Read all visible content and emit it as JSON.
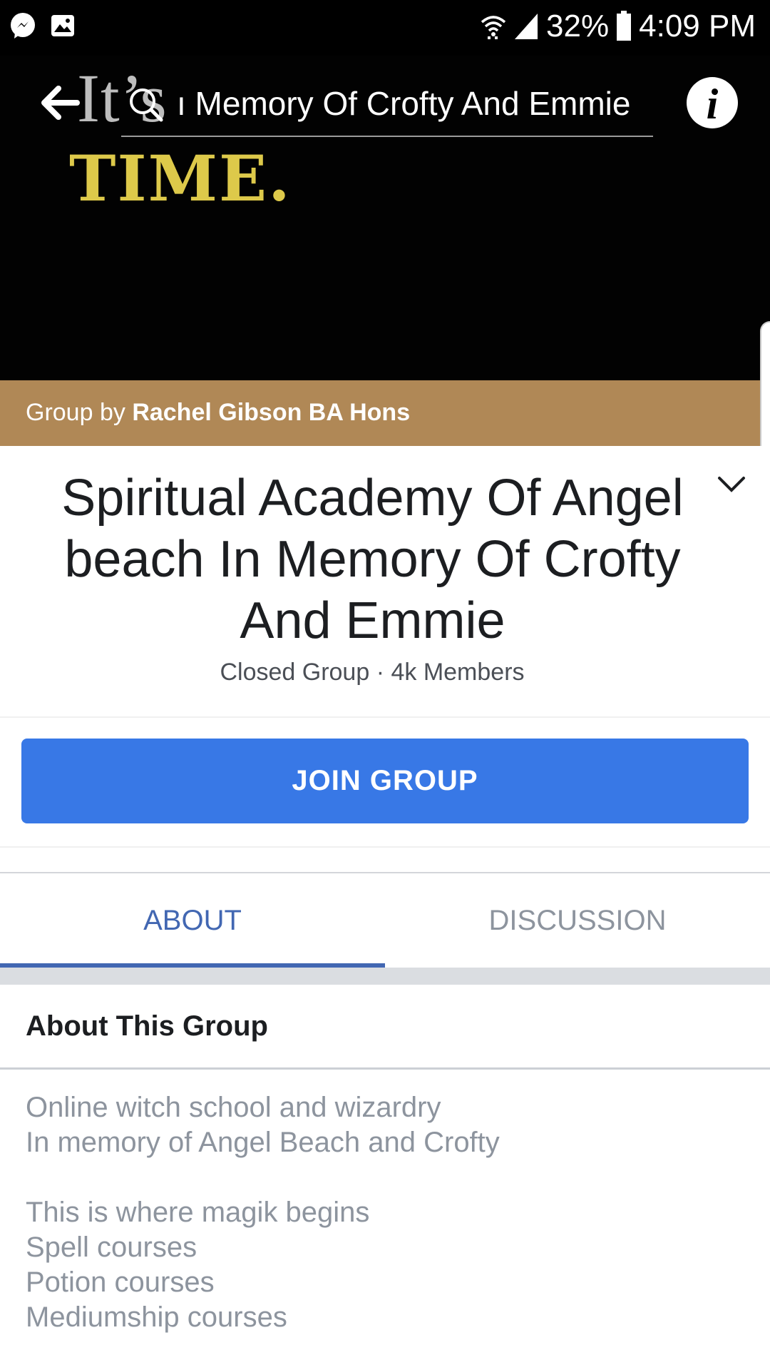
{
  "status_bar": {
    "battery": "32%",
    "time": "4:09 PM",
    "icons": [
      "messenger-icon",
      "gallery-icon",
      "wifi-icon",
      "signal-icon",
      "battery-icon"
    ]
  },
  "cover": {
    "line1": "It’s",
    "line2": "TIME."
  },
  "nav": {
    "search_text": "ı Memory Of Crofty And Emmie",
    "icons": [
      "back-arrow-icon",
      "search-icon",
      "info-icon"
    ]
  },
  "group_by": {
    "prefix": "Group by",
    "owner": "Rachel Gibson BA Hons"
  },
  "group": {
    "title": "Spiritual Academy Of Angel beach In Memory Of Crofty And Emmie",
    "meta": "Closed Group · 4k Members",
    "join_label": "JOIN GROUP"
  },
  "tabs": [
    {
      "label": "ABOUT",
      "active": true
    },
    {
      "label": "DISCUSSION",
      "active": false
    }
  ],
  "about": {
    "heading": "About This Group",
    "lines": [
      "Online witch school and wizardry",
      "In memory of Angel Beach and Crofty",
      "",
      "This is where magik begins",
      "Spell courses",
      "Potion courses",
      "Mediumship courses"
    ]
  },
  "colors": {
    "banner": "#b08856",
    "accent": "#4267b2",
    "join_button": "#3878e6",
    "cover_text_yellow": "#ddc94a"
  }
}
